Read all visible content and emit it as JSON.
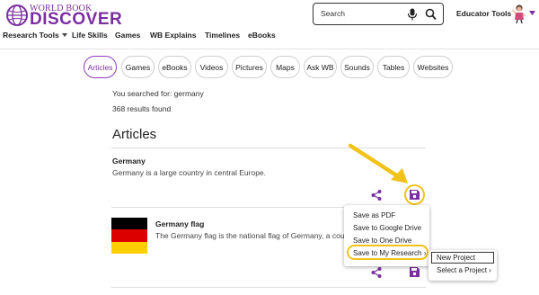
{
  "header": {
    "logo_top": "WORLD BOOK",
    "logo_main": "DISCOVER",
    "search_placeholder": "Search",
    "educator_tools": "Educator Tools"
  },
  "nav": {
    "items": [
      "Research Tools",
      "Life Skills",
      "Games",
      "WB Explains",
      "Timelines",
      "eBooks"
    ]
  },
  "filters": {
    "pills": [
      "Articles",
      "Games",
      "eBooks",
      "Videos",
      "Pictures",
      "Maps",
      "Ask WB",
      "Sounds",
      "Tables",
      "Websites"
    ],
    "active": "Articles"
  },
  "results": {
    "searched_text": "You searched for: germany",
    "count_text": "368 results found",
    "section_heading": "Articles",
    "items": [
      {
        "title": "Germany",
        "description": "Germany is a large country in central Europe."
      },
      {
        "title": "Germany flag",
        "description": "The Germany flag is the national flag of Germany, a cou"
      }
    ]
  },
  "save_menu": {
    "items": [
      "Save as PDF",
      "Save to Google Drive",
      "Save to One Drive",
      "Save to My Research"
    ],
    "highlighted": "Save to My Research"
  },
  "research_submenu": {
    "items": [
      "New Project",
      "Select a Project"
    ],
    "highlighted": "New Project"
  },
  "colors": {
    "brand": "#7b2ea0",
    "accent": "#8d3dbb",
    "highlight": "#f2c21a",
    "flag": [
      "#000000",
      "#dd0000",
      "#ffce00"
    ]
  },
  "icons": [
    "globe-logo-icon",
    "microphone-icon",
    "search-icon",
    "avatar-icon",
    "chevron-down-icon",
    "share-icon",
    "save-icon",
    "arrow-icon"
  ]
}
